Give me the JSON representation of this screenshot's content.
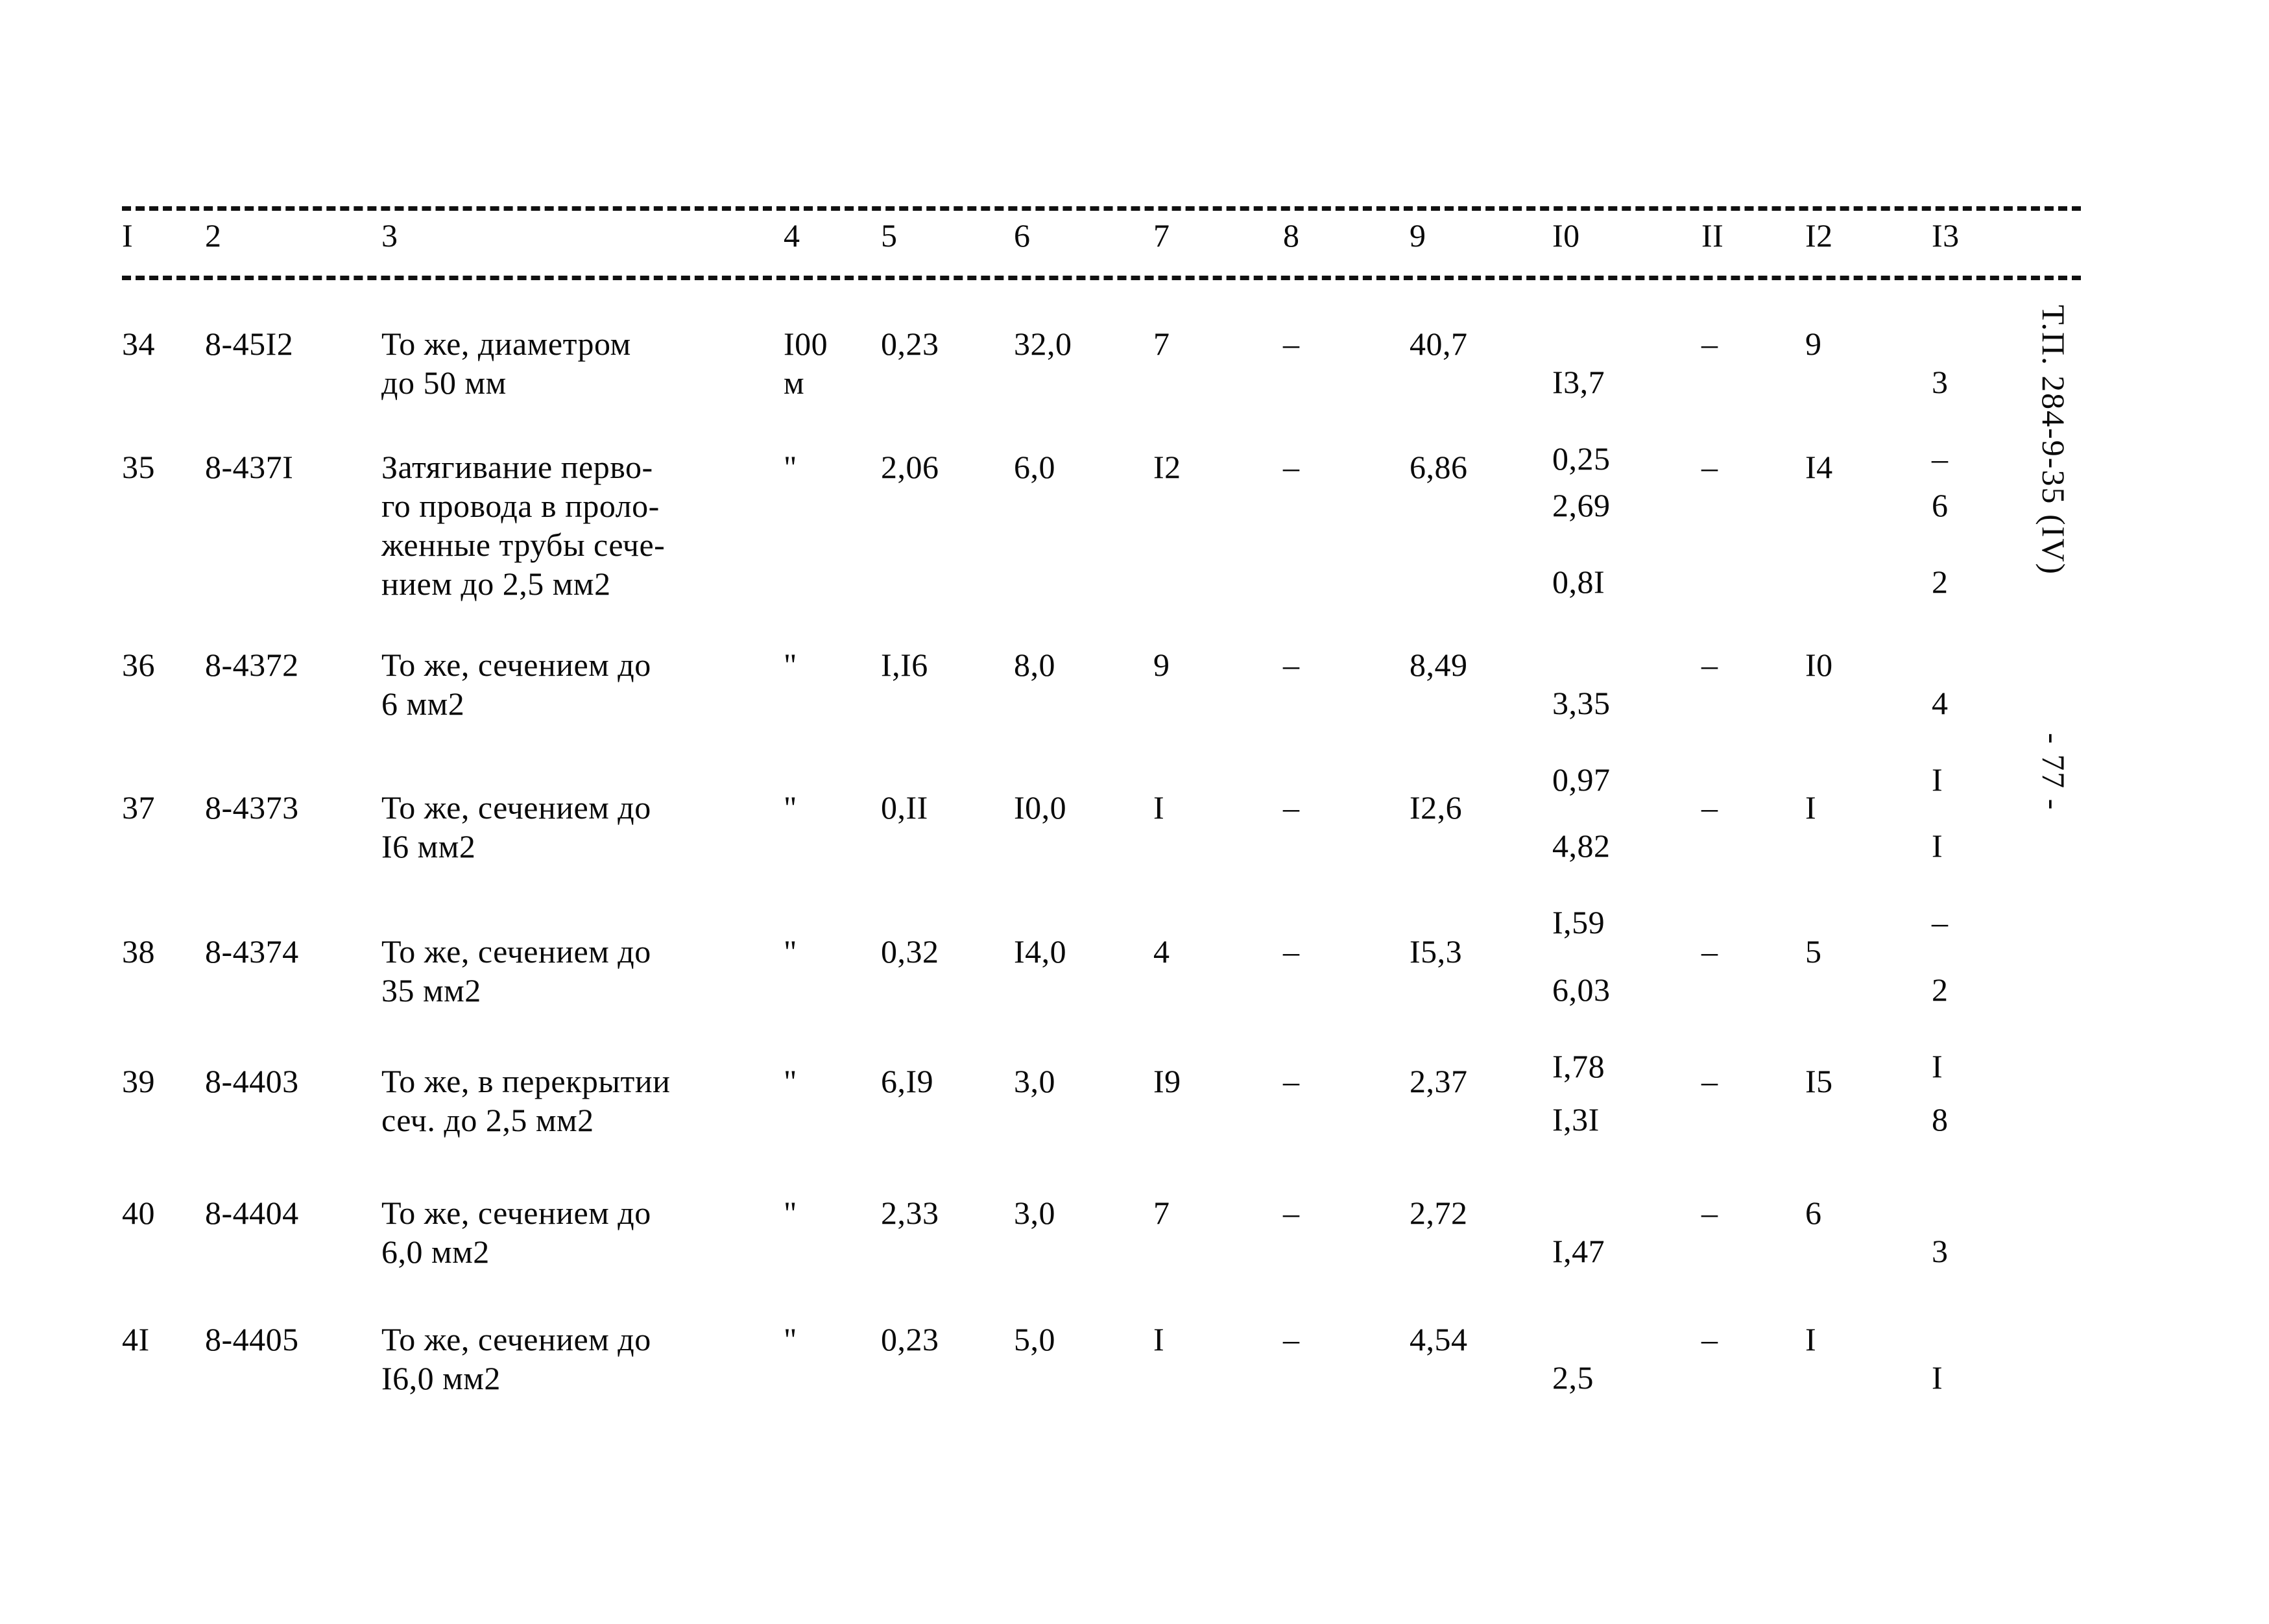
{
  "document": {
    "margin_code": "Т.П. 284-9-35 (IV)",
    "page_marker": "- 77 -"
  },
  "table": {
    "column_headers": [
      "I",
      "2",
      "3",
      "4",
      "5",
      "6",
      "7",
      "8",
      "9",
      "I0",
      "II",
      "I2",
      "I3"
    ],
    "rows": [
      {
        "c1": "34",
        "c2": "8-45I2",
        "c3": "То же, диаметром\nдо 50 мм",
        "c4": "I00\nм",
        "c5": "0,23",
        "c6": "32,0",
        "c7": "7",
        "c8": "–",
        "c9": "40,7",
        "c10_a": "I3,7",
        "c10_b": "0,25",
        "c11": "–",
        "c12": "9",
        "c13_a": "3",
        "c13_b": "–"
      },
      {
        "c1": "35",
        "c2": "8-437I",
        "c3": "Затягивание перво-\nго провода в проло-\nженные трубы сече-\nнием до 2,5 мм2",
        "c4": "\"",
        "c5": "2,06",
        "c6": "6,0",
        "c7": "I2",
        "c8": "–",
        "c9": "6,86",
        "c10_a": "2,69",
        "c10_b": "0,8I",
        "c11": "–",
        "c12": "I4",
        "c13_a": "6",
        "c13_b": "2"
      },
      {
        "c1": "36",
        "c2": "8-4372",
        "c3": "То же, сечением до\n6 мм2",
        "c4": "\"",
        "c5": "I,I6",
        "c6": "8,0",
        "c7": "9",
        "c8": "–",
        "c9": "8,49",
        "c10_a": "3,35",
        "c10_b": "0,97",
        "c11": "–",
        "c12": "I0",
        "c13_a": "4",
        "c13_b": "I"
      },
      {
        "c1": "37",
        "c2": "8-4373",
        "c3": "То же, сечением до\nI6 мм2",
        "c4": "\"",
        "c5": "0,II",
        "c6": "I0,0",
        "c7": "I",
        "c8": "–",
        "c9": "I2,6",
        "c10_a": "4,82",
        "c10_b": "I,59",
        "c11": "–",
        "c12": "I",
        "c13_a": "I",
        "c13_b": "–"
      },
      {
        "c1": "38",
        "c2": "8-4374",
        "c3": "То же, сечением до\n35 мм2",
        "c4": "\"",
        "c5": "0,32",
        "c6": "I4,0",
        "c7": "4",
        "c8": "–",
        "c9": "I5,3",
        "c10_a": "6,03",
        "c10_b": "I,78",
        "c11": "–",
        "c12": "5",
        "c13_a": "2",
        "c13_b": "I"
      },
      {
        "c1": "39",
        "c2": "8-4403",
        "c3": "То же, в перекрытии\nсеч. до 2,5 мм2",
        "c4": "\"",
        "c5": "6,I9",
        "c6": "3,0",
        "c7": "I9",
        "c8": "–",
        "c9": "2,37",
        "c10_a": "I,3I",
        "c10_b": "",
        "c11": "–",
        "c12": "I5",
        "c13_a": "8",
        "c13_b": ""
      },
      {
        "c1": "40",
        "c2": "8-4404",
        "c3": "То же, сечением до\n6,0 мм2",
        "c4": "\"",
        "c5": "2,33",
        "c6": "3,0",
        "c7": "7",
        "c8": "–",
        "c9": "2,72",
        "c10_a": "I,47",
        "c10_b": "",
        "c11": "–",
        "c12": "6",
        "c13_a": "3",
        "c13_b": ""
      },
      {
        "c1": "4I",
        "c2": "8-4405",
        "c3": "То же, сечением до\nI6,0 мм2",
        "c4": "\"",
        "c5": "0,23",
        "c6": "5,0",
        "c7": "I",
        "c8": "–",
        "c9": "4,54",
        "c10_a": "2,5",
        "c10_b": "",
        "c11": "–",
        "c12": "I",
        "c13_a": "I",
        "c13_b": ""
      }
    ]
  }
}
